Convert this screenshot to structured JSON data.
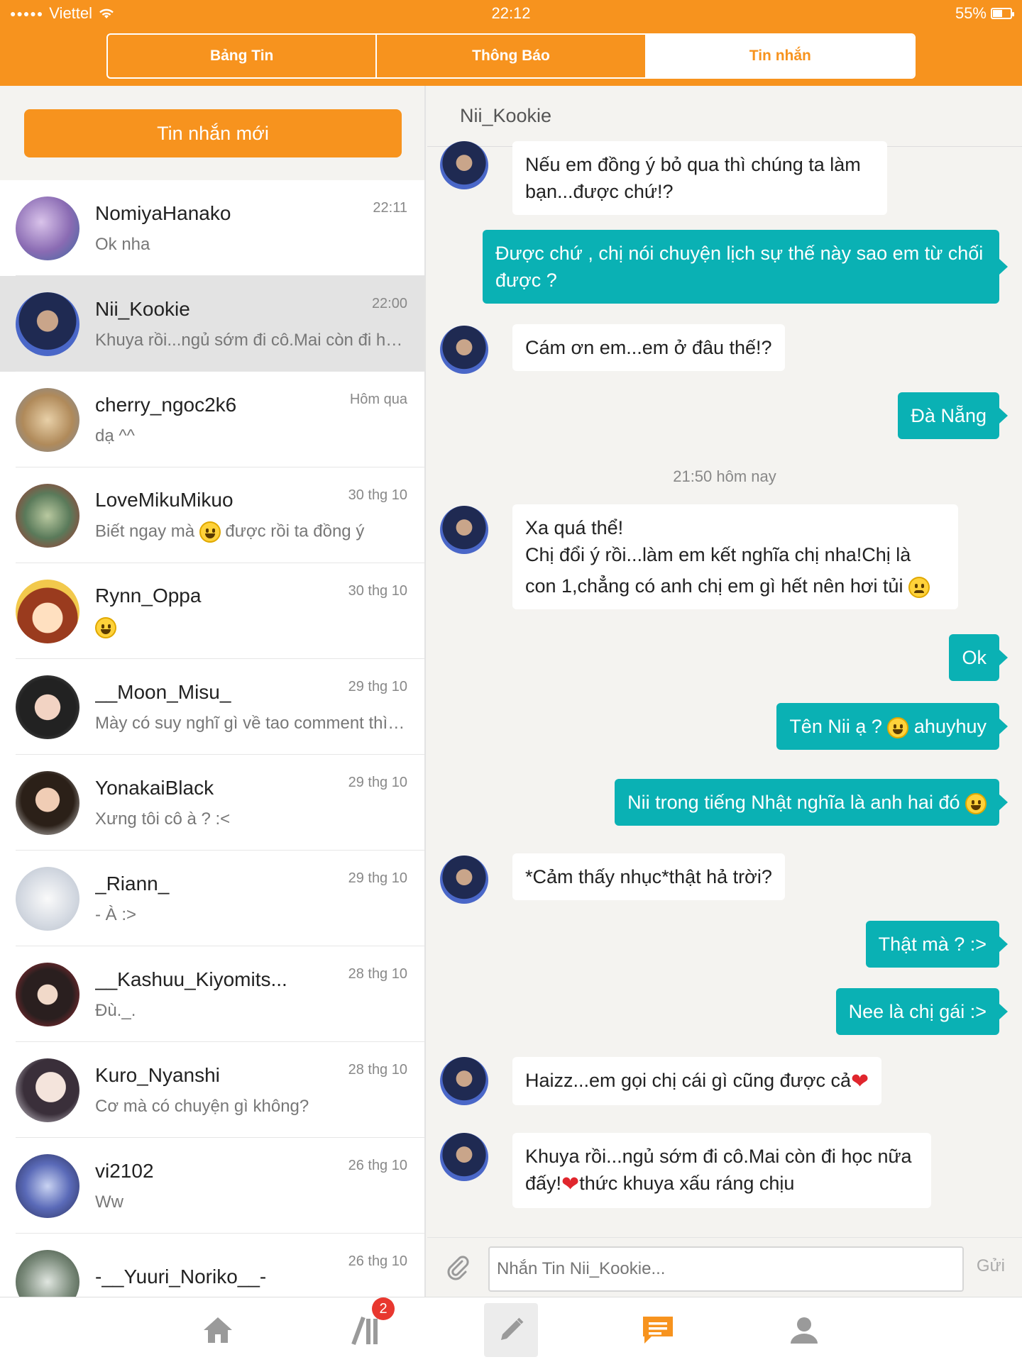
{
  "status_bar": {
    "carrier": "Viettel",
    "time": "22:12",
    "battery": "55%",
    "battery_level": 0.55
  },
  "segments": [
    {
      "label": "Bảng Tin",
      "active": false
    },
    {
      "label": "Thông Báo",
      "active": false
    },
    {
      "label": "Tin nhắn",
      "active": true
    }
  ],
  "sidebar": {
    "new_message_label": "Tin nhắn mới",
    "conversations": [
      {
        "name": "NomiyaHanako",
        "preview": "Ok nha",
        "time": "22:11"
      },
      {
        "name": "Nii_Kookie",
        "preview": "Khuya rồi...ngủ sớm đi cô.Mai còn đi học nữa đấy!",
        "time": "22:00",
        "selected": true
      },
      {
        "name": "cherry_ngoc2k6",
        "preview": "dạ ^^",
        "time": "Hôm qua"
      },
      {
        "name": "LoveMikuMikuo",
        "preview_a": "Biết ngay mà",
        "preview_b": "được rồi ta đồng ý",
        "time": "30 thg 10"
      },
      {
        "name": "Rynn_Oppa",
        "preview": "",
        "time": "30 thg 10"
      },
      {
        "name": "__Moon_Misu_",
        "preview": "Mày có suy nghĩ gì về tao comment thì cứ nói",
        "time": "29 thg 10"
      },
      {
        "name": "YonakaiBlack",
        "preview": "Xưng tôi cô à ? :<",
        "time": "29 thg 10"
      },
      {
        "name": "_Riann_",
        "preview": "- À :>",
        "time": "29 thg 10"
      },
      {
        "name": "__Kashuu_Kiyomits...",
        "preview": "Đù._.",
        "time": "28 thg 10"
      },
      {
        "name": "Kuro_Nyanshi",
        "preview": "Cơ mà có chuyện gì không?",
        "time": "28 thg 10"
      },
      {
        "name": "vi2102",
        "preview": "Ww",
        "time": "26 thg 10"
      },
      {
        "name": "-__Yuuri_Noriko__-",
        "preview": "",
        "time": "26 thg 10"
      }
    ]
  },
  "chat": {
    "title": "Nii_Kookie",
    "messages": [
      {
        "from": "in",
        "text_1": "Nếu em đồng ý bỏ qua thì chúng ta làm",
        "text_2": "bạn...được chứ!?"
      },
      {
        "from": "out",
        "text_1": "Được chứ , chị nói chuyện lịch sự thế này sao em từ chối",
        "text_2": "được ?"
      },
      {
        "from": "in",
        "text": "Cám ơn em...em ở đâu thế!?"
      },
      {
        "from": "out",
        "text": "Đà Nẵng"
      },
      {
        "timestamp": "21:50 hôm nay"
      },
      {
        "from": "in",
        "text_1": "Xa quá thể!",
        "text_2": "Chị đổi ý rồi...làm em kết nghĩa chị nha!Chị là",
        "text_3": "con 1,chẳng có anh chị em gì hết nên hơi tủi"
      },
      {
        "from": "out",
        "text": "Ok"
      },
      {
        "from": "out",
        "text_a": "Tên Nii ạ ?",
        "text_b": "ahuyhuy"
      },
      {
        "from": "out",
        "text": "Nii trong tiếng Nhật nghĩa là anh hai đó"
      },
      {
        "from": "in",
        "text": "*Cảm thấy nhục*thật hả trời?"
      },
      {
        "from": "out",
        "text": "Thật mà ? :>"
      },
      {
        "from": "out",
        "text": "Nee là chị gái :>"
      },
      {
        "from": "in",
        "text": "Haizz...em gọi chị  cái gì cũng được cả"
      },
      {
        "from": "in",
        "text_1": "Khuya rồi...ngủ sớm đi cô.Mai còn đi học nữa",
        "text_2a": "đấy!",
        "text_2b": "thức khuya xấu ráng chịu"
      }
    ],
    "composer_placeholder": "Nhắn Tin Nii_Kookie...",
    "send_label": "Gửi"
  },
  "tabbar": {
    "items": [
      {
        "icon": "home-icon"
      },
      {
        "icon": "library-icon",
        "badge": "2"
      },
      {
        "icon": "pencil-icon"
      },
      {
        "icon": "messages-icon",
        "active": true
      },
      {
        "icon": "profile-icon"
      }
    ]
  },
  "colors": {
    "brand_orange": "#f7931e",
    "teal_bubble": "#0ab1b4",
    "badge_red": "#e8372f"
  }
}
